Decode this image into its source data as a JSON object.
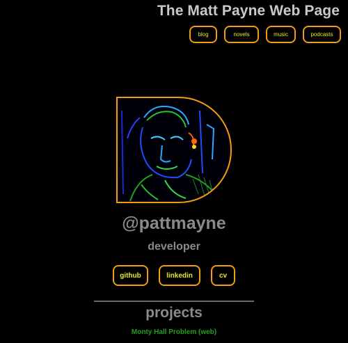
{
  "header": {
    "title": "The Matt Payne Web Page",
    "nav": [
      {
        "label": "blog"
      },
      {
        "label": "novels"
      },
      {
        "label": "music"
      },
      {
        "label": "podcasts"
      }
    ]
  },
  "profile": {
    "handle": "@pattmayne",
    "role": "developer",
    "links": [
      {
        "label": "github"
      },
      {
        "label": "linkedin"
      },
      {
        "label": "cv"
      }
    ]
  },
  "projects": {
    "heading": "projects",
    "items": [
      {
        "label": "Monty Hall Problem (web)"
      }
    ]
  },
  "colors": {
    "accent_border": "#f39c12",
    "button_text": "#e8e82a",
    "project_link": "#1fa21f",
    "muted_text": "#8a8a8a"
  }
}
